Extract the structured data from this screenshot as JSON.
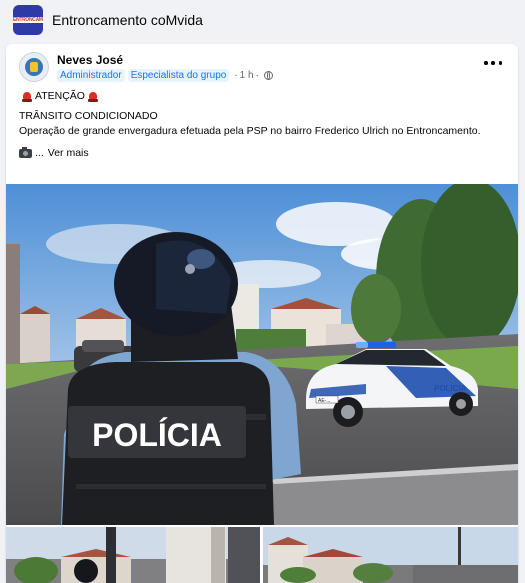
{
  "group": {
    "name": "Entroncamento coMvida",
    "logo_text": "ENTRONCAMENTO"
  },
  "post": {
    "author": "Neves José",
    "badges": [
      "Administrador",
      "Especialista do grupo"
    ],
    "time": "1 h",
    "attention": "ATENÇÃO",
    "headline": "TRÂNSITO CONDICIONADO",
    "body": "Operação de grande envergadura efetuada pela PSP no bairro Frederico Ulrich no Entroncamento.",
    "see_more": "Ver mais",
    "vest_label": "POLÍCIA",
    "car_label": "POLICIA",
    "car_plate": "AE-..."
  },
  "icons": {
    "more": "ellipsis-icon",
    "privacy": "globe-icon",
    "siren": "rotating-light-icon",
    "camera": "camera-icon"
  },
  "colors": {
    "brand_blue": "#1877f2",
    "badge_bg": "#e7f3ff",
    "police_blue": "#1f4fae"
  }
}
